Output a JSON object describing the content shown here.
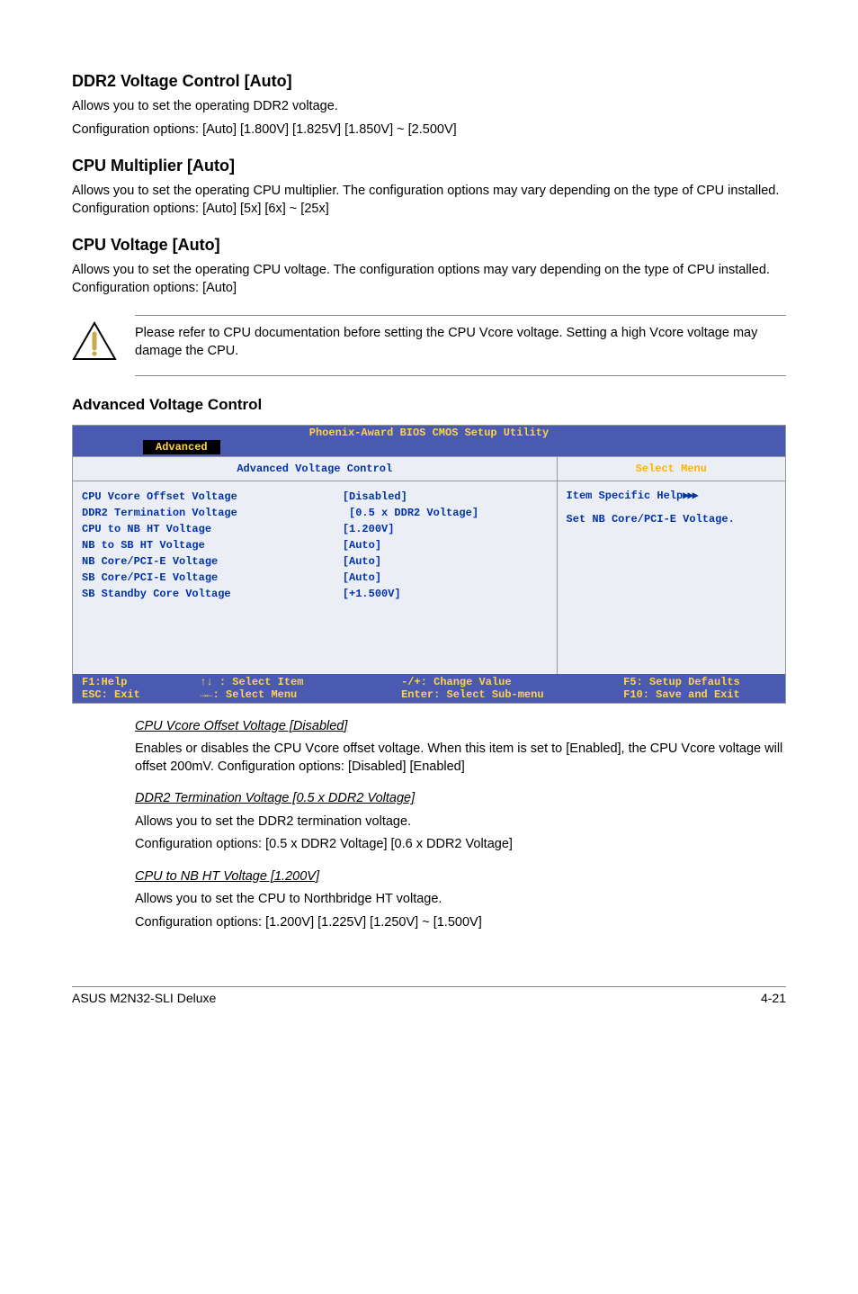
{
  "h_ddr2": "DDR2 Voltage Control [Auto]",
  "p_ddr2_a": "Allows you to set the operating DDR2 voltage.",
  "p_ddr2_b": "Configuration options: [Auto] [1.800V] [1.825V] [1.850V] ~ [2.500V]",
  "h_mult": "CPU Multiplier [Auto]",
  "p_mult": "Allows you to set the operating CPU multiplier. The configuration options may vary depending on the type of CPU installed. Configuration options: [Auto] [5x] [6x] ~ [25x]",
  "h_cpuv": "CPU Voltage [Auto]",
  "p_cpuv": "Allows you to set the operating CPU voltage. The configuration options may vary depending on the type of CPU installed. Configuration options: [Auto]",
  "note": "Please refer to CPU documentation before setting the CPU Vcore voltage. Setting a high Vcore voltage may damage the CPU.",
  "h_avc": "Advanced Voltage Control",
  "bios": {
    "title": "Phoenix-Award BIOS CMOS Setup Utility",
    "tab": "Advanced",
    "panel_heading": "Advanced Voltage Control",
    "right_heading": "Select Menu",
    "rows": [
      {
        "label": "CPU Vcore Offset Voltage",
        "val": "[Disabled]"
      },
      {
        "label": "DDR2 Termination Voltage",
        "val": " [0.5 x DDR2 Voltage]"
      },
      {
        "label": "CPU to NB HT Voltage",
        "val": "[1.200V]"
      },
      {
        "label": "NB to SB HT Voltage",
        "val": "[Auto]"
      },
      {
        "label": "NB Core/PCI-E Voltage",
        "val": "[Auto]"
      },
      {
        "label": "SB Core/PCI-E Voltage",
        "val": "[Auto]"
      },
      {
        "label": "SB Standby Core Voltage",
        "val": "[+1.500V]"
      }
    ],
    "help1": "Item Specific Help",
    "help2": "Set NB Core/PCI-E Voltage.",
    "footer": {
      "c1a": "F1:Help",
      "c1b": "ESC: Exit",
      "c2a": "↑↓ : Select Item",
      "c2b": "→←: Select Menu",
      "c3a": "-/+: Change Value",
      "c3b": "Enter: Select Sub-menu",
      "c4a": "F5: Setup Defaults",
      "c4b": "F10: Save and Exit"
    }
  },
  "sub1_t": "CPU Vcore Offset Voltage [Disabled]",
  "sub1_p": "Enables or disables the CPU Vcore offset voltage. When this item is set to [Enabled], the CPU Vcore voltage will offset 200mV. Configuration options: [Disabled] [Enabled]",
  "sub2_t": "DDR2 Termination Voltage [0.5 x DDR2 Voltage]",
  "sub2_p1": "Allows you to set the DDR2 termination voltage.",
  "sub2_p2": "Configuration options: [0.5 x DDR2 Voltage] [0.6 x DDR2 Voltage]",
  "sub3_t": "CPU to NB HT Voltage [1.200V]",
  "sub3_p1": "Allows you to set the CPU to Northbridge HT voltage.",
  "sub3_p2": "Configuration options: [1.200V] [1.225V] [1.250V] ~ [1.500V]",
  "footer_left": "ASUS M2N32-SLI Deluxe",
  "footer_right": "4-21"
}
